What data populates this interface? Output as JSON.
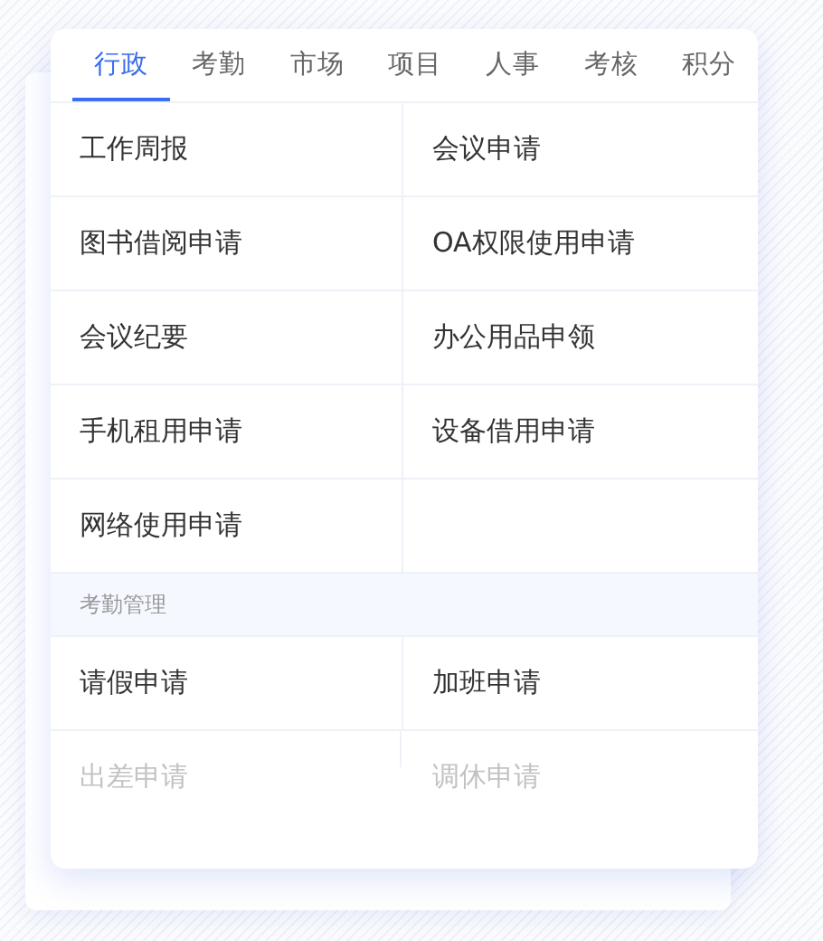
{
  "tabs": [
    {
      "label": "行政",
      "selected": true
    },
    {
      "label": "考勤",
      "selected": false
    },
    {
      "label": "市场",
      "selected": false
    },
    {
      "label": "项目",
      "selected": false
    },
    {
      "label": "人事",
      "selected": false
    },
    {
      "label": "考核",
      "selected": false
    },
    {
      "label": "积分",
      "selected": false
    }
  ],
  "sections": [
    {
      "items": [
        {
          "label": "工作周报",
          "dimmed": false
        },
        {
          "label": "会议申请",
          "dimmed": false
        },
        {
          "label": "图书借阅申请",
          "dimmed": false
        },
        {
          "label": "OA权限使用申请",
          "dimmed": false
        },
        {
          "label": "会议纪要",
          "dimmed": false
        },
        {
          "label": "办公用品申领",
          "dimmed": false
        },
        {
          "label": "手机租用申请",
          "dimmed": false
        },
        {
          "label": "设备借用申请",
          "dimmed": false
        },
        {
          "label": "网络使用申请",
          "dimmed": false
        }
      ]
    },
    {
      "title": "考勤管理",
      "items": [
        {
          "label": "请假申请",
          "dimmed": false
        },
        {
          "label": "加班申请",
          "dimmed": false
        },
        {
          "label": "出差申请",
          "dimmed": true
        },
        {
          "label": "调休申请",
          "dimmed": true
        }
      ]
    }
  ]
}
